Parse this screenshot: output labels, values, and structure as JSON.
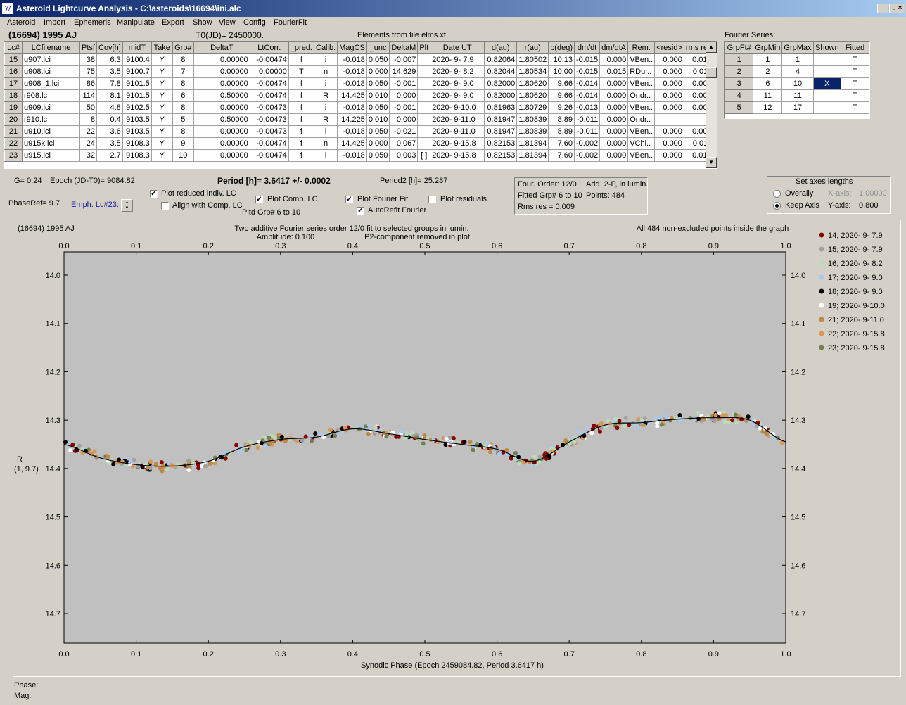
{
  "window": {
    "title": "Asteroid Lightcurve Analysis - C:\\asteroids\\16694\\ini.alc",
    "icon_glyph": "7/"
  },
  "menu": [
    "Asteroid",
    "Import",
    "Ephemeris",
    "Manipulate",
    "Export",
    "Show",
    "View",
    "Config",
    "FourierFit"
  ],
  "header": {
    "asteroid": "(16694) 1995 AJ",
    "t0": "T0(JD)= 2450000.",
    "elements": "Elements from file elms.xt"
  },
  "lc_table": {
    "columns": [
      "Lc#",
      "LCfilename",
      "Ptsf",
      "Cov[h]",
      "midT",
      "Take",
      "Grp#",
      "DeltaT",
      "LtCorr.",
      "_pred.",
      "Calib.",
      "MagCS",
      "_unc",
      "DeltaM",
      "Plt",
      "Date UT",
      "d(au)",
      "r(au)",
      "p(deg)",
      "dm/dt",
      "dm/dtA",
      "Rem.",
      "<resid>",
      "rms res"
    ],
    "rows": [
      [
        "15",
        "u907.lci",
        "38",
        "6.3",
        "9100.4",
        "Y",
        "8",
        "0.00000",
        "-0.00474",
        "f",
        "i",
        "-0.018",
        "0.050",
        "-0.007",
        "",
        "2020- 9- 7.9",
        "0.82064",
        "1.80502",
        "10.13",
        "-0.015",
        "0.000",
        "VBen..",
        "0.000",
        "0.010"
      ],
      [
        "16",
        "u908.lci",
        "75",
        "3.5",
        "9100.7",
        "Y",
        "7",
        "0.00000",
        "0.00000",
        "T",
        "n",
        "-0.018",
        "0.000",
        "14.629",
        "",
        "2020- 9- 8.2",
        "0.82044",
        "1.80534",
        "10.00",
        "-0.015",
        "0.015",
        "RDur..",
        "0.000",
        "0.011"
      ],
      [
        "17",
        "u908_1.lci",
        "86",
        "7.8",
        "9101.5",
        "Y",
        "8",
        "0.00000",
        "-0.00474",
        "f",
        "i",
        "-0.018",
        "0.050",
        "-0.001",
        "",
        "2020- 9- 9.0",
        "0.82000",
        "1.80620",
        "9.66",
        "-0.014",
        "0.000",
        "VBen..",
        "0.000",
        "0.008"
      ],
      [
        "18",
        "r908.lc",
        "114",
        "8.1",
        "9101.5",
        "Y",
        "6",
        "0.50000",
        "-0.00474",
        "f",
        "R",
        "14.425",
        "0.010",
        "0.000",
        "",
        "2020- 9- 9.0",
        "0.82000",
        "1.80620",
        "9.66",
        "-0.014",
        "0.000",
        "Ondr..",
        "0.000",
        "0.007"
      ],
      [
        "19",
        "u909.lci",
        "50",
        "4.8",
        "9102.5",
        "Y",
        "8",
        "0.00000",
        "-0.00473",
        "f",
        "i",
        "-0.018",
        "0.050",
        "-0.001",
        "",
        "2020- 9-10.0",
        "0.81963",
        "1.80729",
        "9.26",
        "-0.013",
        "0.000",
        "VBen..",
        "0.000",
        "0.008"
      ],
      [
        "20",
        "r910.lc",
        "8",
        "0.4",
        "9103.5",
        "Y",
        "5",
        "0.50000",
        "-0.00473",
        "f",
        "R",
        "14.225",
        "0.010",
        "0.000",
        "",
        "2020- 9-11.0",
        "0.81947",
        "1.80839",
        "8.89",
        "-0.011",
        "0.000",
        "Ondr..",
        "",
        ""
      ],
      [
        "21",
        "u910.lci",
        "22",
        "3.6",
        "9103.5",
        "Y",
        "8",
        "0.00000",
        "-0.00473",
        "f",
        "i",
        "-0.018",
        "0.050",
        "-0.021",
        "",
        "2020- 9-11.0",
        "0.81947",
        "1.80839",
        "8.89",
        "-0.011",
        "0.000",
        "VBen..",
        "0.000",
        "0.009"
      ],
      [
        "22",
        "u915k.lci",
        "24",
        "3.5",
        "9108.3",
        "Y",
        "9",
        "0.00000",
        "-0.00474",
        "f",
        "n",
        "14.425",
        "0.000",
        "0.067",
        "",
        "2020- 9-15.8",
        "0.82153",
        "1.81394",
        "7.60",
        "-0.002",
        "0.000",
        "VChi..",
        "0.000",
        "0.011"
      ],
      [
        "23",
        "u915.lci",
        "32",
        "2.7",
        "9108.3",
        "Y",
        "10",
        "0.00000",
        "-0.00474",
        "f",
        "i",
        "-0.018",
        "0.050",
        "0.003",
        "[ ]",
        "2020- 9-15.8",
        "0.82153",
        "1.81394",
        "7.60",
        "-0.002",
        "0.000",
        "VBen..",
        "0.000",
        "0.010"
      ]
    ]
  },
  "fourier": {
    "label": "Fourier Series:",
    "columns": [
      "GrpFt#",
      "GrpMin",
      "GrpMax",
      "Shown",
      "Fitted"
    ],
    "rows": [
      [
        "1",
        "1",
        "1",
        "",
        "T"
      ],
      [
        "2",
        "2",
        "4",
        "",
        "T"
      ],
      [
        "3",
        "6",
        "10",
        "X",
        "T"
      ],
      [
        "4",
        "11",
        "11",
        "",
        "T"
      ],
      [
        "5",
        "12",
        "17",
        "",
        "T"
      ]
    ]
  },
  "info": {
    "g": "G= 0.24",
    "epoch": "Epoch (JD-T0)= 9084.82",
    "period": "Period [h]= 3.6417 +/- 0.0002",
    "period2": "Period2 [h]= 25.287",
    "phaseref": "PhaseRef= 9.7",
    "emph": "Emph. Lc#23:",
    "pltd": "Pltd Grp#  6  to   10"
  },
  "checkboxes": [
    {
      "label": "Plot reduced indiv. LC",
      "checked": true
    },
    {
      "label": "Align with Comp. LC",
      "checked": false
    },
    {
      "label": "Plot Comp. LC",
      "checked": true
    },
    {
      "label": "Plot Fourier Fit",
      "checked": true
    },
    {
      "label": "AutoRefit Fourier",
      "checked": true
    },
    {
      "label": "Plot residuals",
      "checked": false
    }
  ],
  "fit_info": {
    "line1": "Four. Order: 12/0",
    "line1b": "Add. 2-P, in lumin.",
    "line2": "Fitted Grp# 6 to 10",
    "line2b": "Points: 484",
    "line3": "Rms res      = 0.009"
  },
  "axes": {
    "title": "Set axes lengths",
    "overall": "Overally",
    "keep": "Keep Axis",
    "xlabel": "X-axis:",
    "xval": "1.00000",
    "ylabel": "Y-axis:",
    "yval": "0.800"
  },
  "plot": {
    "name": "(16694) 1995 AJ",
    "title1": "Two additive Fourier series order 12/0 fit to selected groups in lumin.",
    "title2": "Amplitude: 0.100",
    "title3": "P2-component removed in plot",
    "all_points": "All 484 non-excluded points inside the graph",
    "ylabel1": "R",
    "ylabel2": "(1, 9.7)",
    "xlabel": "Synodic Phase (Epoch 2459084.82, Period 3.6417 h)"
  },
  "status": {
    "phase": "Phase:",
    "mag": "Mag:"
  },
  "chart_data": {
    "type": "scatter",
    "xlim": [
      0.0,
      1.0
    ],
    "ylim": [
      14.4,
      13.65
    ],
    "x_ticks": [
      "0.0",
      "0.1",
      "0.2",
      "0.3",
      "0.4",
      "0.5",
      "0.6",
      "0.7",
      "0.8",
      "0.9",
      "1.0"
    ],
    "y_ticks": [
      "14.0",
      "14.1",
      "14.2",
      "14.3",
      "14.4",
      "14.5",
      "14.6",
      "14.7"
    ],
    "y_tick_values": [
      14.0,
      14.1,
      14.2,
      14.3,
      14.4,
      14.5,
      14.6,
      14.7
    ],
    "fit_curve": {
      "x": [
        0.0,
        0.05,
        0.1,
        0.15,
        0.2,
        0.25,
        0.3,
        0.35,
        0.4,
        0.45,
        0.5,
        0.55,
        0.6,
        0.65,
        0.7,
        0.75,
        0.8,
        0.85,
        0.9,
        0.95,
        1.0
      ],
      "y": [
        14.35,
        14.378,
        14.392,
        14.395,
        14.385,
        14.355,
        14.34,
        14.335,
        14.318,
        14.328,
        14.34,
        14.35,
        14.36,
        14.385,
        14.345,
        14.31,
        14.305,
        14.298,
        14.295,
        14.3,
        14.345
      ]
    },
    "series": [
      {
        "name": "14; 2020- 9- 7.9",
        "color": "#8b0000"
      },
      {
        "name": "15; 2020- 9- 7.9",
        "color": "#a0a0a0"
      },
      {
        "name": "16; 2020- 9- 8.2",
        "color": "#b8dcb8"
      },
      {
        "name": "17; 2020- 9- 9.0",
        "color": "#a8c8f0"
      },
      {
        "name": "18; 2020- 9- 9.0",
        "color": "#000000"
      },
      {
        "name": "19; 2020- 9-10.0",
        "color": "#ffffff"
      },
      {
        "name": "21; 2020- 9-11.0",
        "color": "#c08848"
      },
      {
        "name": "22; 2020- 9-15.8",
        "color": "#d89858"
      },
      {
        "name": "23; 2020- 9-15.8",
        "color": "#708050"
      }
    ]
  }
}
